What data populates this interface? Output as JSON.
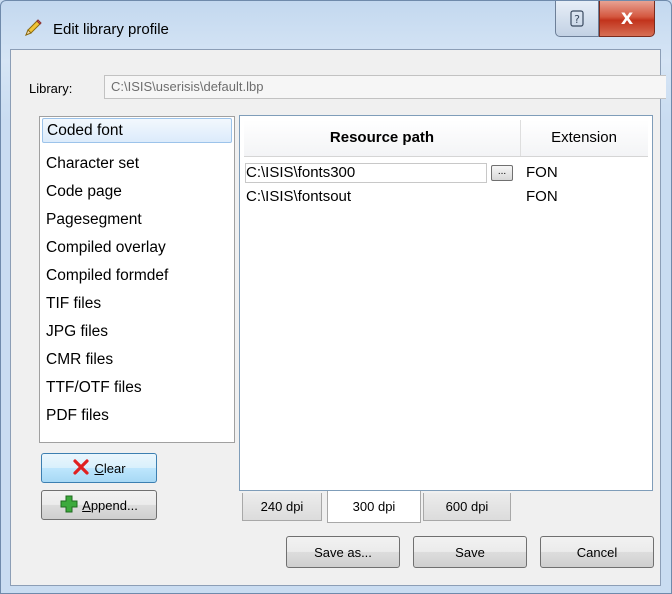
{
  "window": {
    "title": "Edit library profile",
    "help_label": "?",
    "close_label": "X"
  },
  "library": {
    "label": "Library:",
    "value": "C:\\ISIS\\userisis\\default.lbp"
  },
  "resource_types": [
    {
      "label": "Coded font",
      "selected": true
    },
    {
      "label": "Character set"
    },
    {
      "label": "Code page"
    },
    {
      "label": "Pagesegment"
    },
    {
      "label": "Compiled overlay"
    },
    {
      "label": "Compiled formdef"
    },
    {
      "label": "TIF files"
    },
    {
      "label": "JPG files"
    },
    {
      "label": "CMR files"
    },
    {
      "label": "TTF/OTF files"
    },
    {
      "label": "PDF files"
    }
  ],
  "buttons": {
    "clear_prefix": "",
    "clear_mnemonic": "C",
    "clear_rest": "lear",
    "append_mnemonic": "A",
    "append_rest": "ppend...",
    "save_as": "Save as...",
    "save": "Save",
    "cancel": "Cancel",
    "browse": "..."
  },
  "table": {
    "columns": [
      "Resource path",
      "Extension"
    ],
    "rows": [
      {
        "path": "C:\\ISIS\\fonts300",
        "ext": "FON",
        "editing": true
      },
      {
        "path": "C:\\ISIS\\fontsout",
        "ext": "FON"
      }
    ]
  },
  "dpi_tabs": [
    {
      "label": "240 dpi"
    },
    {
      "label": "300 dpi",
      "active": true
    },
    {
      "label": "600 dpi"
    }
  ],
  "colors": {
    "selection": "#dcebfb",
    "close_button": "#c2331c",
    "clear_icon": "#e02020",
    "append_icon": "#3caa3c"
  }
}
